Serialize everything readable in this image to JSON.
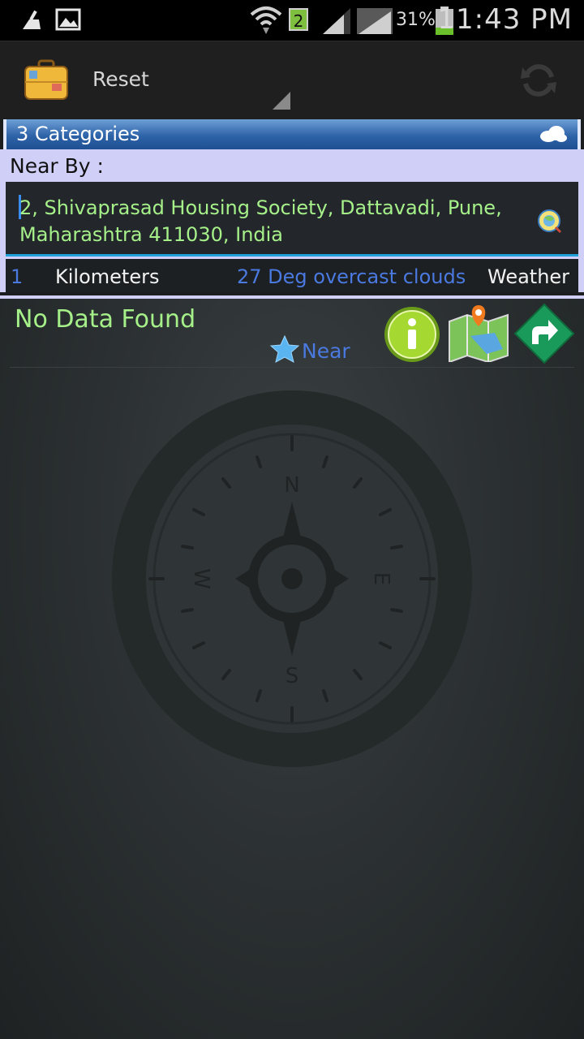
{
  "status_bar": {
    "sim_badge": "2",
    "battery_percent": "31%",
    "time": "11:43 PM"
  },
  "action_bar": {
    "title": "Reset"
  },
  "categories_header": {
    "title": "3 Categories"
  },
  "near_by": {
    "label": "Near By :",
    "address_value": "2, Shivaprasad Housing Society, Dattavadi, Pune, Maharashtra 411030, India",
    "distance": "1",
    "distance_unit": "Kilometers",
    "weather_text": "27 Deg overcast clouds",
    "weather_label": "Weather"
  },
  "results": {
    "status_text": "No Data Found",
    "near_label": "Near"
  },
  "compass": {
    "north": "N",
    "south": "S",
    "east": "E",
    "west": "W"
  },
  "colors": {
    "accent_green": "#a6f08a",
    "accent_blue": "#4a79e0",
    "header_blue": "#2e63a8",
    "panel_lavender": "#cfcff8"
  }
}
